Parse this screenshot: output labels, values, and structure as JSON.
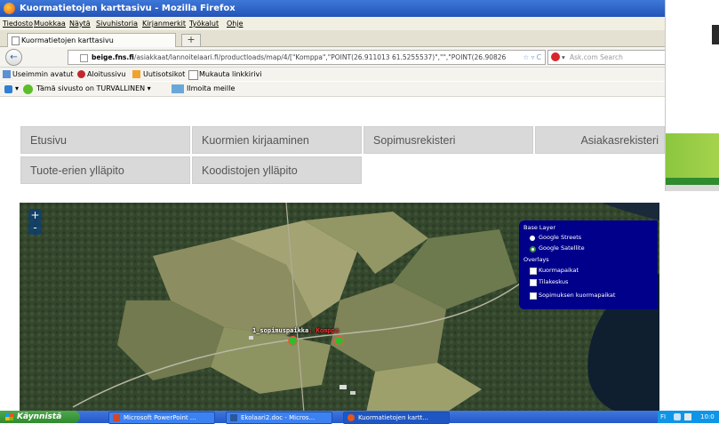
{
  "window": {
    "title": "Kuormatietojen karttasivu - Mozilla Firefox"
  },
  "menu": {
    "items": [
      "Tiedosto",
      "Muokkaa",
      "Näytä",
      "Sivuhistoria",
      "Kirjanmerkit",
      "Työkalut",
      "Ohje"
    ]
  },
  "tab": {
    "label": "Kuormatietojen karttasivu",
    "new_tab": "+"
  },
  "nav": {
    "back": "←",
    "url_host": "beige.fns.fi",
    "url_path": "/asiakkaat/lannoitelaari.fi/productloads/map/4/[\"Komppa\",\"POINT(26.911013 61.5255537)\",\"\",\"POINT(26.90826",
    "url_controls": "☆ ▿ C",
    "search_placeholder": "Ask.com Search"
  },
  "bookmarks": {
    "items": [
      "Useimmin avatut",
      "Aloitussivu",
      "Uutisotsikot",
      "Mukauta linkkirivi"
    ]
  },
  "addons": {
    "status": "Tämä sivusto on TURVALLINEN",
    "report": "Ilmoita meille"
  },
  "site_nav": {
    "row1": [
      "Etusivu",
      "Kuormien kirjaaminen",
      "Sopimusrekisteri",
      "Asiakasrekisteri"
    ],
    "row2": [
      "Tuote-erien ylläpito",
      "Koodistojen ylläpito"
    ]
  },
  "map": {
    "zoom_in": "+",
    "zoom_out": "-",
    "layers": {
      "base_title": "Base Layer",
      "base_options": [
        "Google Streets",
        "Google Satellite"
      ],
      "selected_base": "Google Satellite",
      "overlay_title": "Overlays",
      "overlays": [
        "Kuormapaikat",
        "Tilakeskus",
        "Sopimuksen kuormapaikat"
      ]
    },
    "marker_label_prefix": "1_sopimuspaikka",
    "marker_label_sep": ":",
    "marker_label_name": "Komppa"
  },
  "taskbar": {
    "start": "Käynnistä",
    "tasks": [
      "Microsoft PowerPoint ...",
      "Ekolaari2.doc - Micros...",
      "Kuormatietojen kartt..."
    ],
    "tray_lang": "FI",
    "clock": "10:0"
  },
  "colors": {
    "titlebar": "#2d5fc4",
    "nav_button_bg": "#d9d9d9",
    "layer_switcher": "#00008b",
    "marker": "#2dbd2d",
    "label_highlight": "#ff2a2a",
    "taskbar": "#2458c9"
  }
}
